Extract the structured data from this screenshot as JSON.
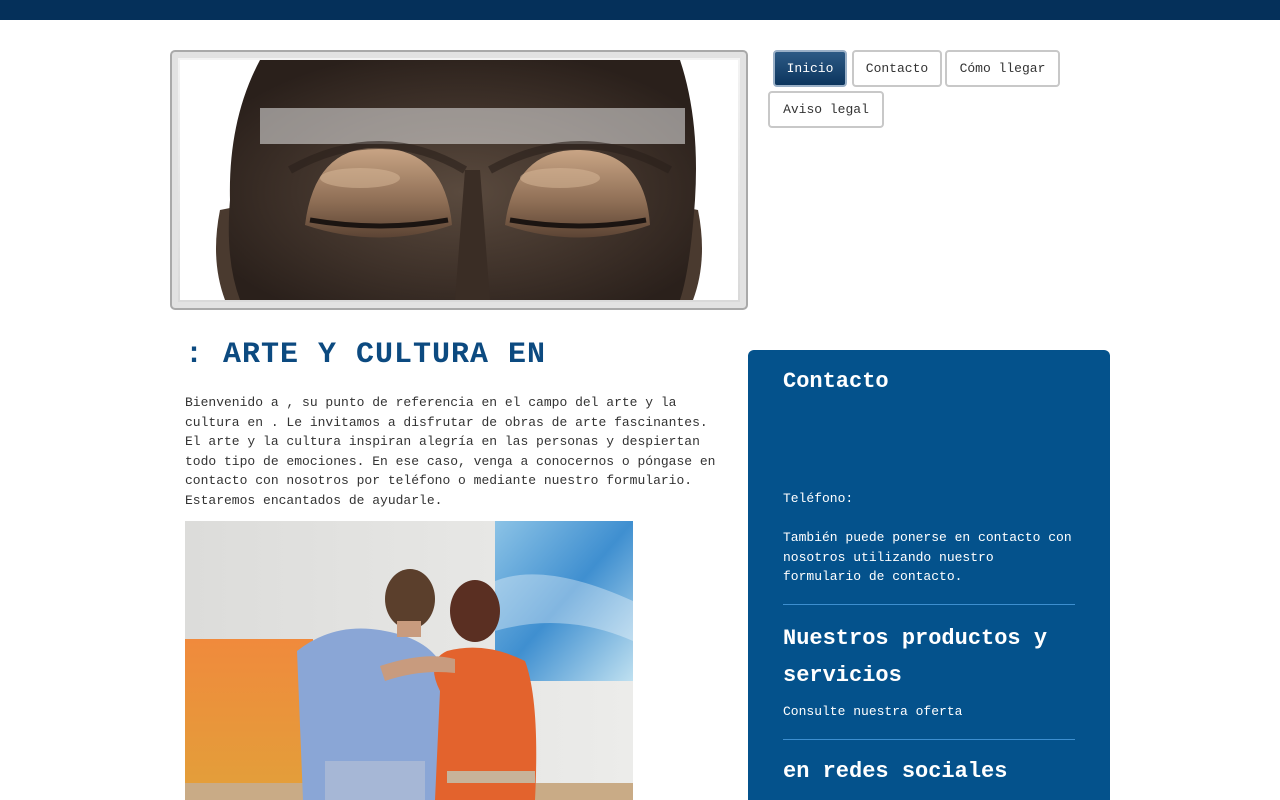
{
  "nav": {
    "items": [
      {
        "label": "Inicio",
        "active": true
      },
      {
        "label": "Contacto",
        "active": false
      },
      {
        "label": "Cómo llegar",
        "active": false
      },
      {
        "label": "Aviso legal",
        "active": false
      }
    ]
  },
  "main": {
    "title": ": ARTE Y CULTURA EN",
    "intro": "Bienvenido a , su punto de referencia en el campo del arte y la cultura en . Le invitamos a disfrutar de obras de arte fascinantes. El arte y la cultura inspiran alegría en las personas y despiertan todo tipo de emociones. En ese caso, venga a conocernos o póngase en contacto con nosotros por teléfono o mediante nuestro formulario. Estaremos encantados de ayudarle."
  },
  "sidebar": {
    "contact_heading": "Contacto",
    "phone_label": "Teléfono:",
    "contact_text": "También puede ponerse en contacto con nosotros utilizando nuestro formulario de contacto.",
    "products_heading": "Nuestros productos y servicios",
    "products_link": "Consulte nuestra oferta",
    "social_heading": "en redes sociales"
  },
  "colors": {
    "topbar": "#05305a",
    "accent": "#04528c",
    "title": "#0c4a80",
    "nav_active": "#0c355e"
  }
}
